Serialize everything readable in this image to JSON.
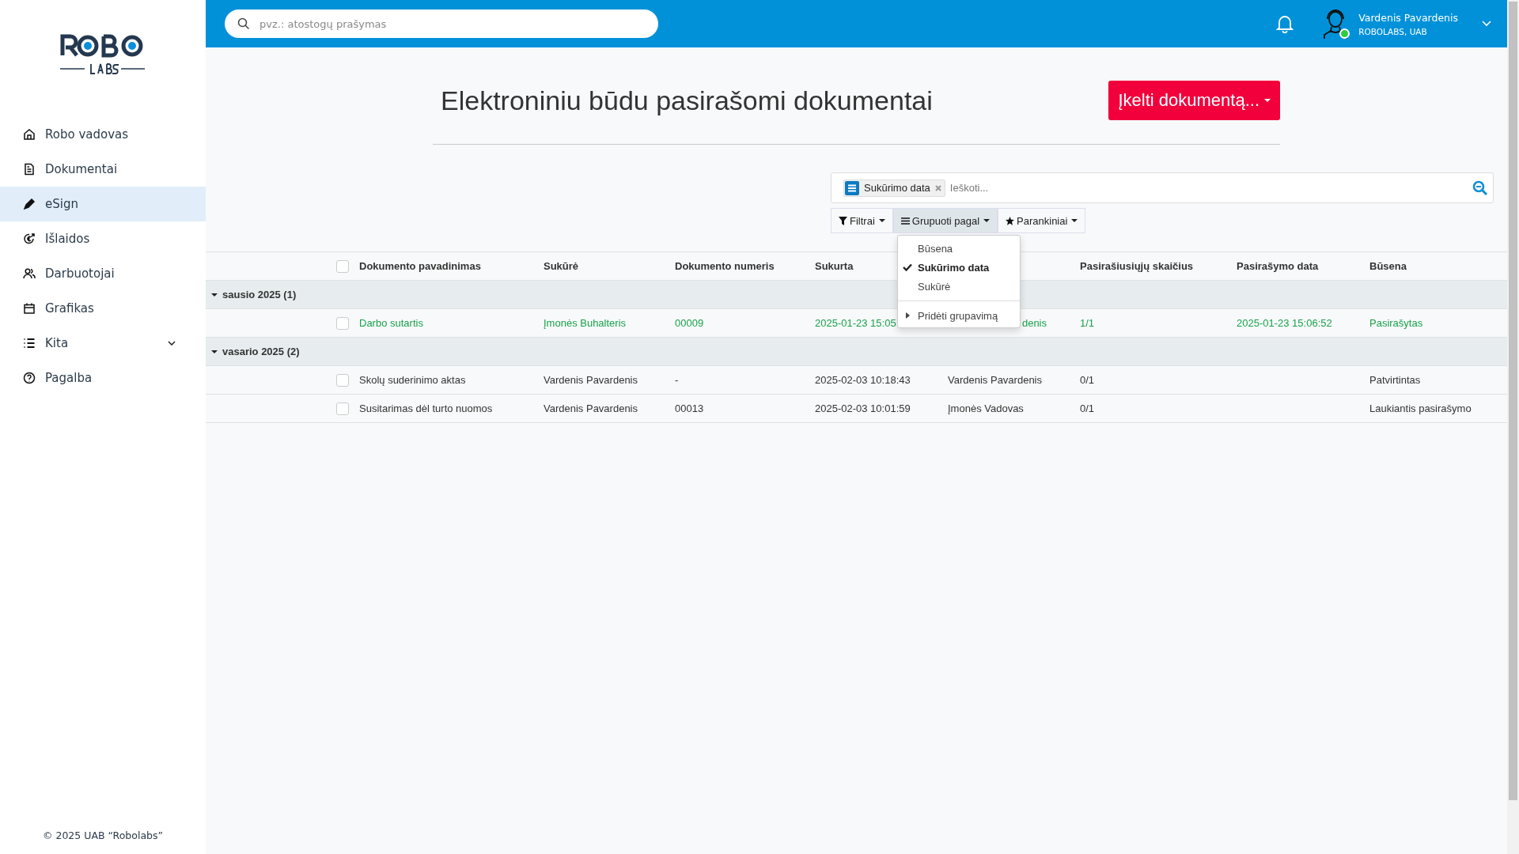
{
  "sidebar": {
    "items": [
      {
        "label": "Robo vadovas",
        "kind": "link",
        "selected": false
      },
      {
        "label": "Dokumentai",
        "kind": "link",
        "selected": false
      },
      {
        "label": "eSign",
        "kind": "link",
        "selected": true
      },
      {
        "label": "Išlaidos",
        "kind": "link",
        "selected": false
      },
      {
        "label": "Darbuotojai",
        "kind": "link",
        "selected": false
      },
      {
        "label": "Grafikas",
        "kind": "link",
        "selected": false
      },
      {
        "label": "Kita",
        "kind": "submenu",
        "selected": false
      },
      {
        "label": "Pagalba",
        "kind": "link",
        "selected": false
      }
    ],
    "footer": "© 2025 UAB “Robolabs”"
  },
  "header": {
    "search": {
      "placeholder": "pvz.: atostogų prašymas"
    },
    "user": {
      "name": "Vardenis Pavardenis",
      "company": "ROBOLABS, UAB",
      "online": true
    }
  },
  "page": {
    "title": "Elektroniniu būdu pasirašomi dokumentai",
    "upload_button": "Įkelti dokumentą..."
  },
  "search": {
    "facet": "Sukūrimo data",
    "placeholder": "Ieškoti..."
  },
  "toolbar": [
    {
      "label": "Filtrai",
      "selected": false
    },
    {
      "label": "Grupuoti pagal",
      "selected": true
    },
    {
      "label": "Parankiniai",
      "selected": false
    }
  ],
  "group_menu": {
    "options": [
      {
        "label": "Būsena",
        "checked": false
      },
      {
        "label": "Sukūrimo data",
        "checked": true
      },
      {
        "label": "Sukūrė",
        "checked": false
      }
    ],
    "add_group": "Pridėti grupavimą"
  },
  "table": {
    "select_all": {
      "checked": false
    },
    "columns": [
      "Dokumento pavadinimas",
      "Sukūrė",
      "Dokumento numeris",
      "Sukurta",
      null,
      "Pasirašiusiųjų skaičius",
      "Pasirašymo data",
      "Būsena"
    ],
    "groups": [
      {
        "label": "sausio 2025 (1)",
        "expanded": true,
        "rows": [
          {
            "signed": true,
            "checked": false,
            "cells": [
              "Darbo sutartis",
              "Įmonės Buhalteris",
              "00009",
              "2025-01-23 15:05",
              {
                "text": "denis",
                "covered": true
              },
              "1/1",
              "2025-01-23 15:06:52",
              "Pasirašytas"
            ]
          }
        ]
      },
      {
        "label": "vasario 2025 (2)",
        "expanded": true,
        "rows": [
          {
            "signed": false,
            "checked": false,
            "cells": [
              "Skolų suderinimo aktas",
              "Vardenis Pavardenis",
              "-",
              "2025-02-03 10:18:43",
              "Vardenis Pavardenis",
              "0/1",
              null,
              "Patvirtintas"
            ]
          },
          {
            "signed": false,
            "checked": false,
            "cells": [
              "Susitarimas dėl turto nuomos",
              "Vardenis Pavardenis",
              "00013",
              "2025-02-03 10:01:59",
              "Įmonės Vadovas",
              "0/1",
              null,
              "Laukiantis pasirašymo"
            ]
          }
        ]
      }
    ]
  }
}
